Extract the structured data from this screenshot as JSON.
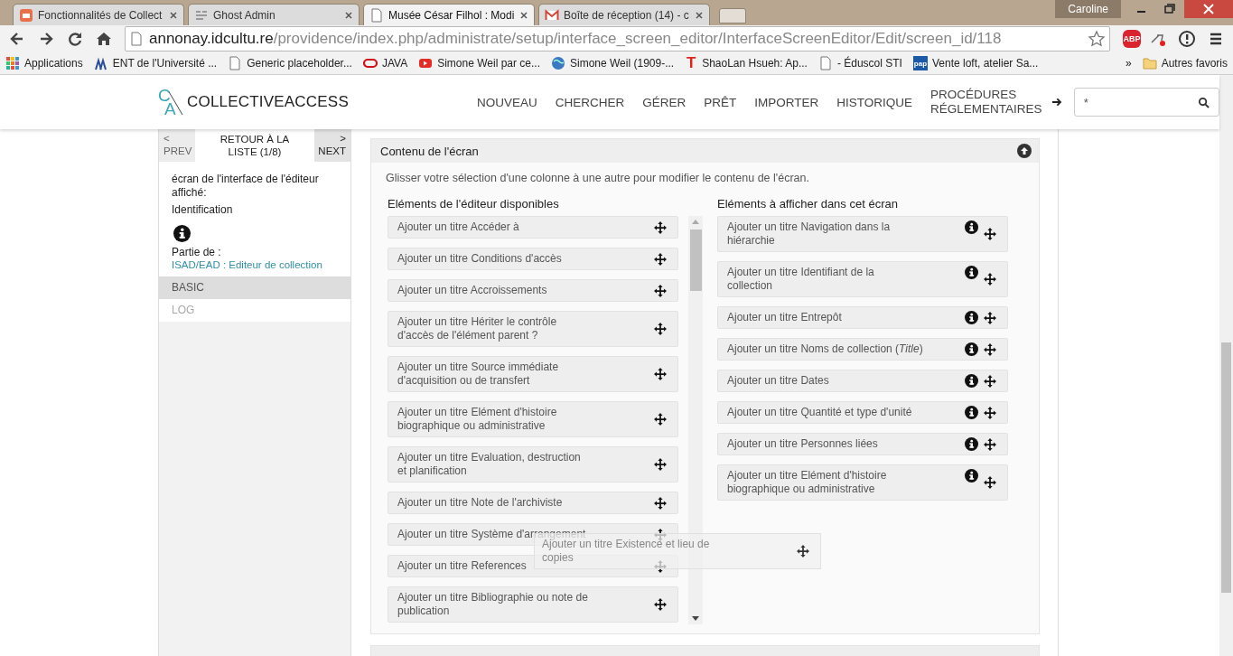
{
  "browser": {
    "tabs": [
      {
        "title": "Fonctionnalités de Collect",
        "kind": "app",
        "selected": false
      },
      {
        "title": "Ghost Admin",
        "kind": "lines",
        "selected": false
      },
      {
        "title": "Musée César Filhol : Modi",
        "kind": "page",
        "selected": true
      },
      {
        "title": "Boîte de réception (14) - c",
        "kind": "mail",
        "selected": false
      }
    ],
    "user": "Caroline",
    "url": {
      "host": "annonay.idcultu.re",
      "path": "/providence/index.php/administrate/setup/interface_screen_editor/InterfaceScreenEditor/Edit/screen_id/118"
    },
    "extension_label": "ABP",
    "bookmarks": [
      {
        "label": "Applications",
        "kind": "apps"
      },
      {
        "label": "ENT de l'Université ...",
        "kind": "figures"
      },
      {
        "label": "Generic placeholder...",
        "kind": "page"
      },
      {
        "label": "JAVA",
        "kind": "ring"
      },
      {
        "label": "Simone Weil par ce...",
        "kind": "video"
      },
      {
        "label": "Simone Weil (1909-...",
        "kind": "globe"
      },
      {
        "label": "ShaoLan Hsueh: Ap...",
        "kind": "letter",
        "icon_text": "T"
      },
      {
        "label": "- Éduscol STI",
        "kind": "page"
      },
      {
        "label": "Vente loft, atelier Sa...",
        "kind": "letter",
        "icon_text": "pap"
      }
    ],
    "overflow": "»",
    "other_bookmarks": "Autres favoris"
  },
  "header": {
    "logo_mark": [
      "C",
      "A"
    ],
    "logo_text": "COLLECTIVEACCESS",
    "nav": [
      "NOUVEAU",
      "CHERCHER",
      "GÉRER",
      "PRÊT",
      "IMPORTER",
      "HISTORIQUE",
      "PROCÉDURES RÉGLEMENTAIRES"
    ],
    "search": {
      "value": "*"
    }
  },
  "sidebar": {
    "prev": {
      "arrow": "<",
      "label": "PREV",
      "disabled": true
    },
    "back": "RETOUR À LA LISTE (1/8)",
    "next": {
      "arrow": ">",
      "label": "NEXT",
      "disabled": false
    },
    "info_label": "écran de l'interface de l'éditeur affiché:",
    "info_value": "Identification",
    "part_of_label": "Partie de :",
    "part_of_link": "ISAD/EAD : Editeur de collection",
    "items": [
      {
        "label": "BASIC",
        "selected": true
      },
      {
        "label": "LOG",
        "selected": false
      }
    ]
  },
  "panel": {
    "title": "Contenu de l'écran",
    "description": "Glisser votre sélection d'une colonne à une autre pour modifier le contenu de l'écran.",
    "available": {
      "heading": "Eléments de l'éditeur disponibles",
      "items": [
        "Ajouter un titre Accéder à",
        "Ajouter un titre Conditions d'accès",
        "Ajouter un titre Accroissements",
        "Ajouter un titre Hériter le contrôle\nd'accès de l'élément parent ?",
        "Ajouter un titre Source immédiate\nd'acquisition ou de transfert",
        "Ajouter un titre Elément d'histoire\nbiographique ou administrative",
        "Ajouter un titre Evaluation, destruction\net planification",
        "Ajouter un titre Note de l'archiviste",
        "Ajouter un titre Système d'arrangement",
        "Ajouter un titre References",
        "Ajouter un titre Bibliographie ou note de\npublication"
      ]
    },
    "shown": {
      "heading": "Eléments à afficher dans cet écran",
      "items": [
        "Ajouter un titre Navigation dans la\nhiérarchie",
        "Ajouter un titre Identifiant de la\ncollection",
        "Ajouter un titre Entrepôt",
        "Ajouter un titre Noms de collection (*Title*)",
        "Ajouter un titre Dates",
        "Ajouter un titre Quantité et type d'unité",
        "Ajouter un titre Personnes liées",
        "Ajouter un titre Elément d'histoire\nbiographique ou administrative"
      ]
    },
    "dragging": "Ajouter un titre Existence et lieu de\ncopies"
  }
}
